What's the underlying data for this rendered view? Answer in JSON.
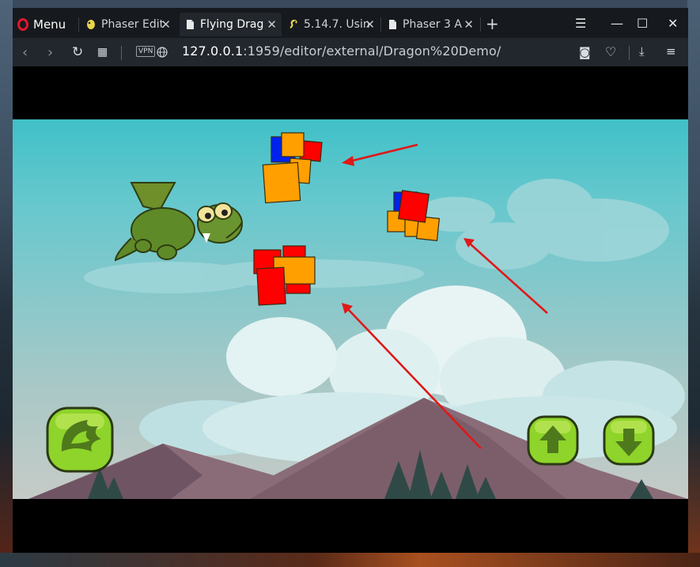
{
  "browser": {
    "menu_label": "Menu",
    "tabs": [
      {
        "label": "Phaser Edit",
        "active": false
      },
      {
        "label": "Flying Drag",
        "active": true
      },
      {
        "label": "5.14.7. Usin",
        "active": false
      },
      {
        "label": "Phaser 3 A",
        "active": false
      }
    ],
    "new_tab_symbol": "+",
    "vpn_label": "VPN",
    "url_host": "127.0.0.1",
    "url_path": ":1959/editor/external/Dragon%20Demo/"
  },
  "game": {
    "scene": "Flying Dragon demo",
    "colors": {
      "sky_top": "#40c0c8",
      "block_red": "#ff0000",
      "block_orange": "#ffa000",
      "block_blue": "#0022ee",
      "arrow": "#e01818",
      "button_green": "#8fd42a"
    },
    "buttons": [
      {
        "name": "fire-button",
        "icon": "fire-breath-icon"
      },
      {
        "name": "up-button",
        "icon": "arrow-up-icon"
      },
      {
        "name": "down-button",
        "icon": "arrow-down-icon"
      }
    ]
  }
}
